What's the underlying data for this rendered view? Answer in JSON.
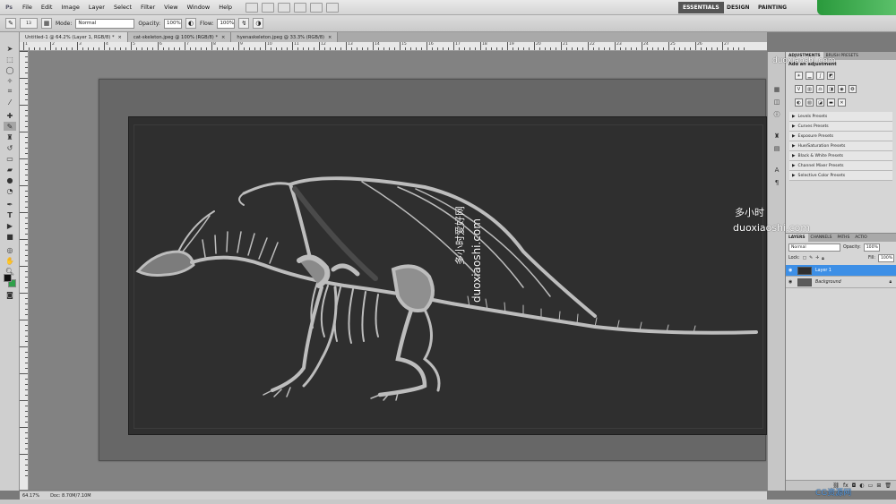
{
  "app": {
    "logo": "Ps",
    "menu": [
      "File",
      "Edit",
      "Image",
      "Layer",
      "Select",
      "Filter",
      "View",
      "Window",
      "Help"
    ],
    "workspaces": [
      "ESSENTIALS",
      "DESIGN",
      "PAINTING"
    ]
  },
  "options": {
    "mode_label": "Mode:",
    "mode_value": "Normal",
    "opacity_label": "Opacity:",
    "opacity_value": "100%",
    "flow_label": "Flow:",
    "flow_value": "100%",
    "brush_size": "13"
  },
  "tabs": [
    {
      "label": "Untitled-1 @ 64.2% (Layer 1, RGB/8) *"
    },
    {
      "label": "cat-skeleton.jpeg @ 100% (RGB/8) *"
    },
    {
      "label": "hyenaskeleton.jpeg @ 33.3% (RGB/8)"
    }
  ],
  "ruler_numbers": [
    "1",
    "2",
    "3",
    "4",
    "5",
    "6",
    "7",
    "8",
    "9",
    "10",
    "11",
    "12",
    "13",
    "14",
    "15",
    "16",
    "17",
    "18",
    "19",
    "20",
    "21",
    "22",
    "23",
    "24",
    "25",
    "26",
    "27"
  ],
  "status": {
    "zoom": "64.17%",
    "doc": "Doc: 8.70M/7.10M"
  },
  "panels": {
    "top_tabs": [
      "ADJUSTMENTS",
      "MASKS",
      "STYLES"
    ],
    "adj_tabs": [
      "ADJUSTMENTS",
      "BRUSH PRESETS"
    ],
    "add_adjustment": "Add an adjustment",
    "presets": [
      "Levels Presets",
      "Curves Presets",
      "Exposure Presets",
      "Hue/Saturation Presets",
      "Black & White Presets",
      "Channel Mixer Presets",
      "Selective Color Presets"
    ],
    "layer_tabs": [
      "LAYERS",
      "CHANNELS",
      "PATHS",
      "ACTIO"
    ],
    "blend_mode": "Normal",
    "opacity_label": "Opacity:",
    "opacity_value": "100%",
    "lock_label": "Lock:",
    "fill_label": "Fill:",
    "fill_value": "100%",
    "layers": [
      {
        "name": "Layer 1",
        "active": true
      },
      {
        "name": "Background",
        "active": false
      }
    ]
  },
  "watermarks": {
    "site": "duoxiaoshi.com",
    "site_cn": "多小时爱好网",
    "brand": "多小时",
    "corner": "CG资源网"
  },
  "colors": {
    "accent": "#3d8fe6",
    "canvas_bg": "#2f2f2f",
    "fg_swatch": "#111111",
    "bg_swatch": "#2fa04a"
  }
}
